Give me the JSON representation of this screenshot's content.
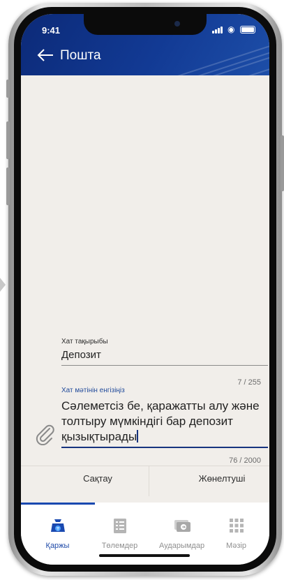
{
  "status": {
    "time": "9:41"
  },
  "header": {
    "title": "Пошта"
  },
  "form": {
    "subject_label": "Хат тақырыбы",
    "subject_value": "Депозит",
    "subject_counter": "7 / 255",
    "message_label": "Хат мәтінін енгізіңіз",
    "message_lines": [
      "Сәлеметсіз бе, қаражатты алу және",
      "толтыру мүмкіндігі бар депозит",
      "қызықтырады"
    ],
    "message_counter": "76 / 2000"
  },
  "actions": {
    "save": "Сақтау",
    "send": "Жөнелтуші"
  },
  "tabs": [
    {
      "label": "Қаржы",
      "icon": "wallet-icon",
      "active": true
    },
    {
      "label": "Төлемдер",
      "icon": "receipt-icon",
      "active": false
    },
    {
      "label": "Аударымдар",
      "icon": "transfer-card-icon",
      "active": false
    },
    {
      "label": "Мәзір",
      "icon": "menu-grid-icon",
      "active": false
    }
  ],
  "colors": {
    "header": "#123a94",
    "accent": "#1a49b0",
    "background": "#f1eeea"
  }
}
